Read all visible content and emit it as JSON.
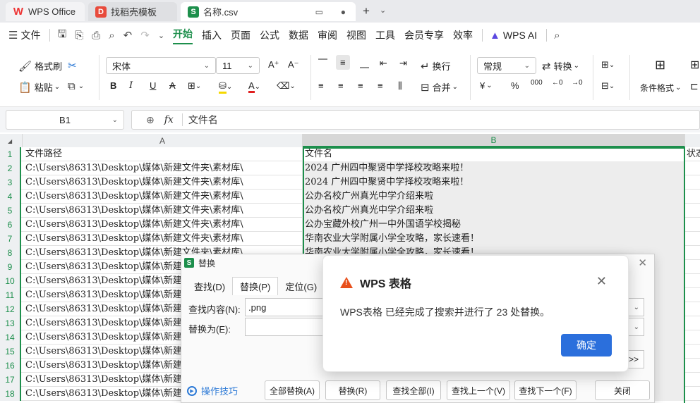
{
  "tabs": {
    "wps_office": "WPS Office",
    "templates": "找稻壳模板",
    "file": "名称.csv"
  },
  "menu": {
    "items": [
      "文件",
      "开始",
      "插入",
      "页面",
      "公式",
      "数据",
      "审阅",
      "视图",
      "工具",
      "会员专享",
      "效率",
      "WPS AI"
    ]
  },
  "ribbon": {
    "format_painter": "格式刷",
    "paste": "粘贴",
    "font_name": "宋体",
    "font_size": "11",
    "wrap": "换行",
    "merge": "合并",
    "number_format": "常规",
    "convert": "转换",
    "cond_format": "条件格式",
    "bold": "B",
    "italic": "I",
    "underline": "U",
    "strike": "A"
  },
  "formula_bar": {
    "cell_ref": "B1",
    "fx": "fx",
    "value": "文件名"
  },
  "grid": {
    "col_a": "A",
    "col_b": "B",
    "rows": [
      {
        "n": "1",
        "a": "文件路径",
        "b": "文件名",
        "c": "状态"
      },
      {
        "n": "2",
        "a": "C:\\Users\\86313\\Desktop\\媒体\\新建文件夹\\素材库\\",
        "b": "2024 广州四中聚贤中学择校攻略来啦！",
        "c": ""
      },
      {
        "n": "3",
        "a": "C:\\Users\\86313\\Desktop\\媒体\\新建文件夹\\素材库\\",
        "b": "2024 广州四中聚贤中学择校攻略来啦！",
        "c": ""
      },
      {
        "n": "4",
        "a": "C:\\Users\\86313\\Desktop\\媒体\\新建文件夹\\素材库\\",
        "b": "公办名校广州真光中学介绍来啦",
        "c": ""
      },
      {
        "n": "5",
        "a": "C:\\Users\\86313\\Desktop\\媒体\\新建文件夹\\素材库\\",
        "b": "公办名校广州真光中学介绍来啦",
        "c": ""
      },
      {
        "n": "6",
        "a": "C:\\Users\\86313\\Desktop\\媒体\\新建文件夹\\素材库\\",
        "b": "公办宝藏外校广州一中外国语学校揭秘",
        "c": ""
      },
      {
        "n": "7",
        "a": "C:\\Users\\86313\\Desktop\\媒体\\新建文件夹\\素材库\\",
        "b": "华南农业大学附属小学全攻略，家长速看！",
        "c": ""
      },
      {
        "n": "8",
        "a": "C:\\Users\\86313\\Desktop\\媒体\\新建文件夹\\素材库\\",
        "b": "华南农业大学附属小学全攻略，家长速看！",
        "c": ""
      },
      {
        "n": "9",
        "a": "C:\\Users\\86313\\Desktop\\媒体\\新建文件夹\\素材库\\",
        "b": "",
        "c": ""
      },
      {
        "n": "10",
        "a": "C:\\Users\\86313\\Desktop\\媒体\\新建文件夹\\素材库\\",
        "b": "",
        "c": ""
      },
      {
        "n": "11",
        "a": "C:\\Users\\86313\\Desktop\\媒体\\新建文件夹\\素材库\\",
        "b": "",
        "c": ""
      },
      {
        "n": "12",
        "a": "C:\\Users\\86313\\Desktop\\媒体\\新建文件夹\\素材库\\",
        "b": "",
        "c": ""
      },
      {
        "n": "13",
        "a": "C:\\Users\\86313\\Desktop\\媒体\\新建文件夹\\素材库\\",
        "b": "",
        "c": ""
      },
      {
        "n": "14",
        "a": "C:\\Users\\86313\\Desktop\\媒体\\新建文件夹\\素材库\\",
        "b": "",
        "c": ""
      },
      {
        "n": "15",
        "a": "C:\\Users\\86313\\Desktop\\媒体\\新建文件夹\\素材库\\",
        "b": "",
        "c": ""
      },
      {
        "n": "16",
        "a": "C:\\Users\\86313\\Desktop\\媒体\\新建文件夹\\素材库\\",
        "b": "",
        "c": ""
      },
      {
        "n": "17",
        "a": "C:\\Users\\86313\\Desktop\\媒体\\新建文件夹\\素材库\\",
        "b": "",
        "c": ""
      },
      {
        "n": "18",
        "a": "C:\\Users\\86313\\Desktop\\媒体\\新建文件夹\\素材库\\",
        "b": "",
        "c": ""
      }
    ]
  },
  "replace_dialog": {
    "title": "替换",
    "tabs": [
      "查找(D)",
      "替换(P)",
      "定位(G)"
    ],
    "find_label": "查找内容(N):",
    "find_value": ".png",
    "replace_label": "替换为(E):",
    "replace_value": "",
    "more": ">>",
    "tips": "操作技巧",
    "buttons": {
      "replace_all": "全部替换(A)",
      "replace": "替换(R)",
      "find_all": "查找全部(I)",
      "find_prev": "查找上一个(V)",
      "find_next": "查找下一个(F)",
      "close": "关闭"
    }
  },
  "message_box": {
    "title": "WPS 表格",
    "message": "WPS表格 已经完成了搜索并进行了 23 处替换。",
    "ok": "确定"
  }
}
